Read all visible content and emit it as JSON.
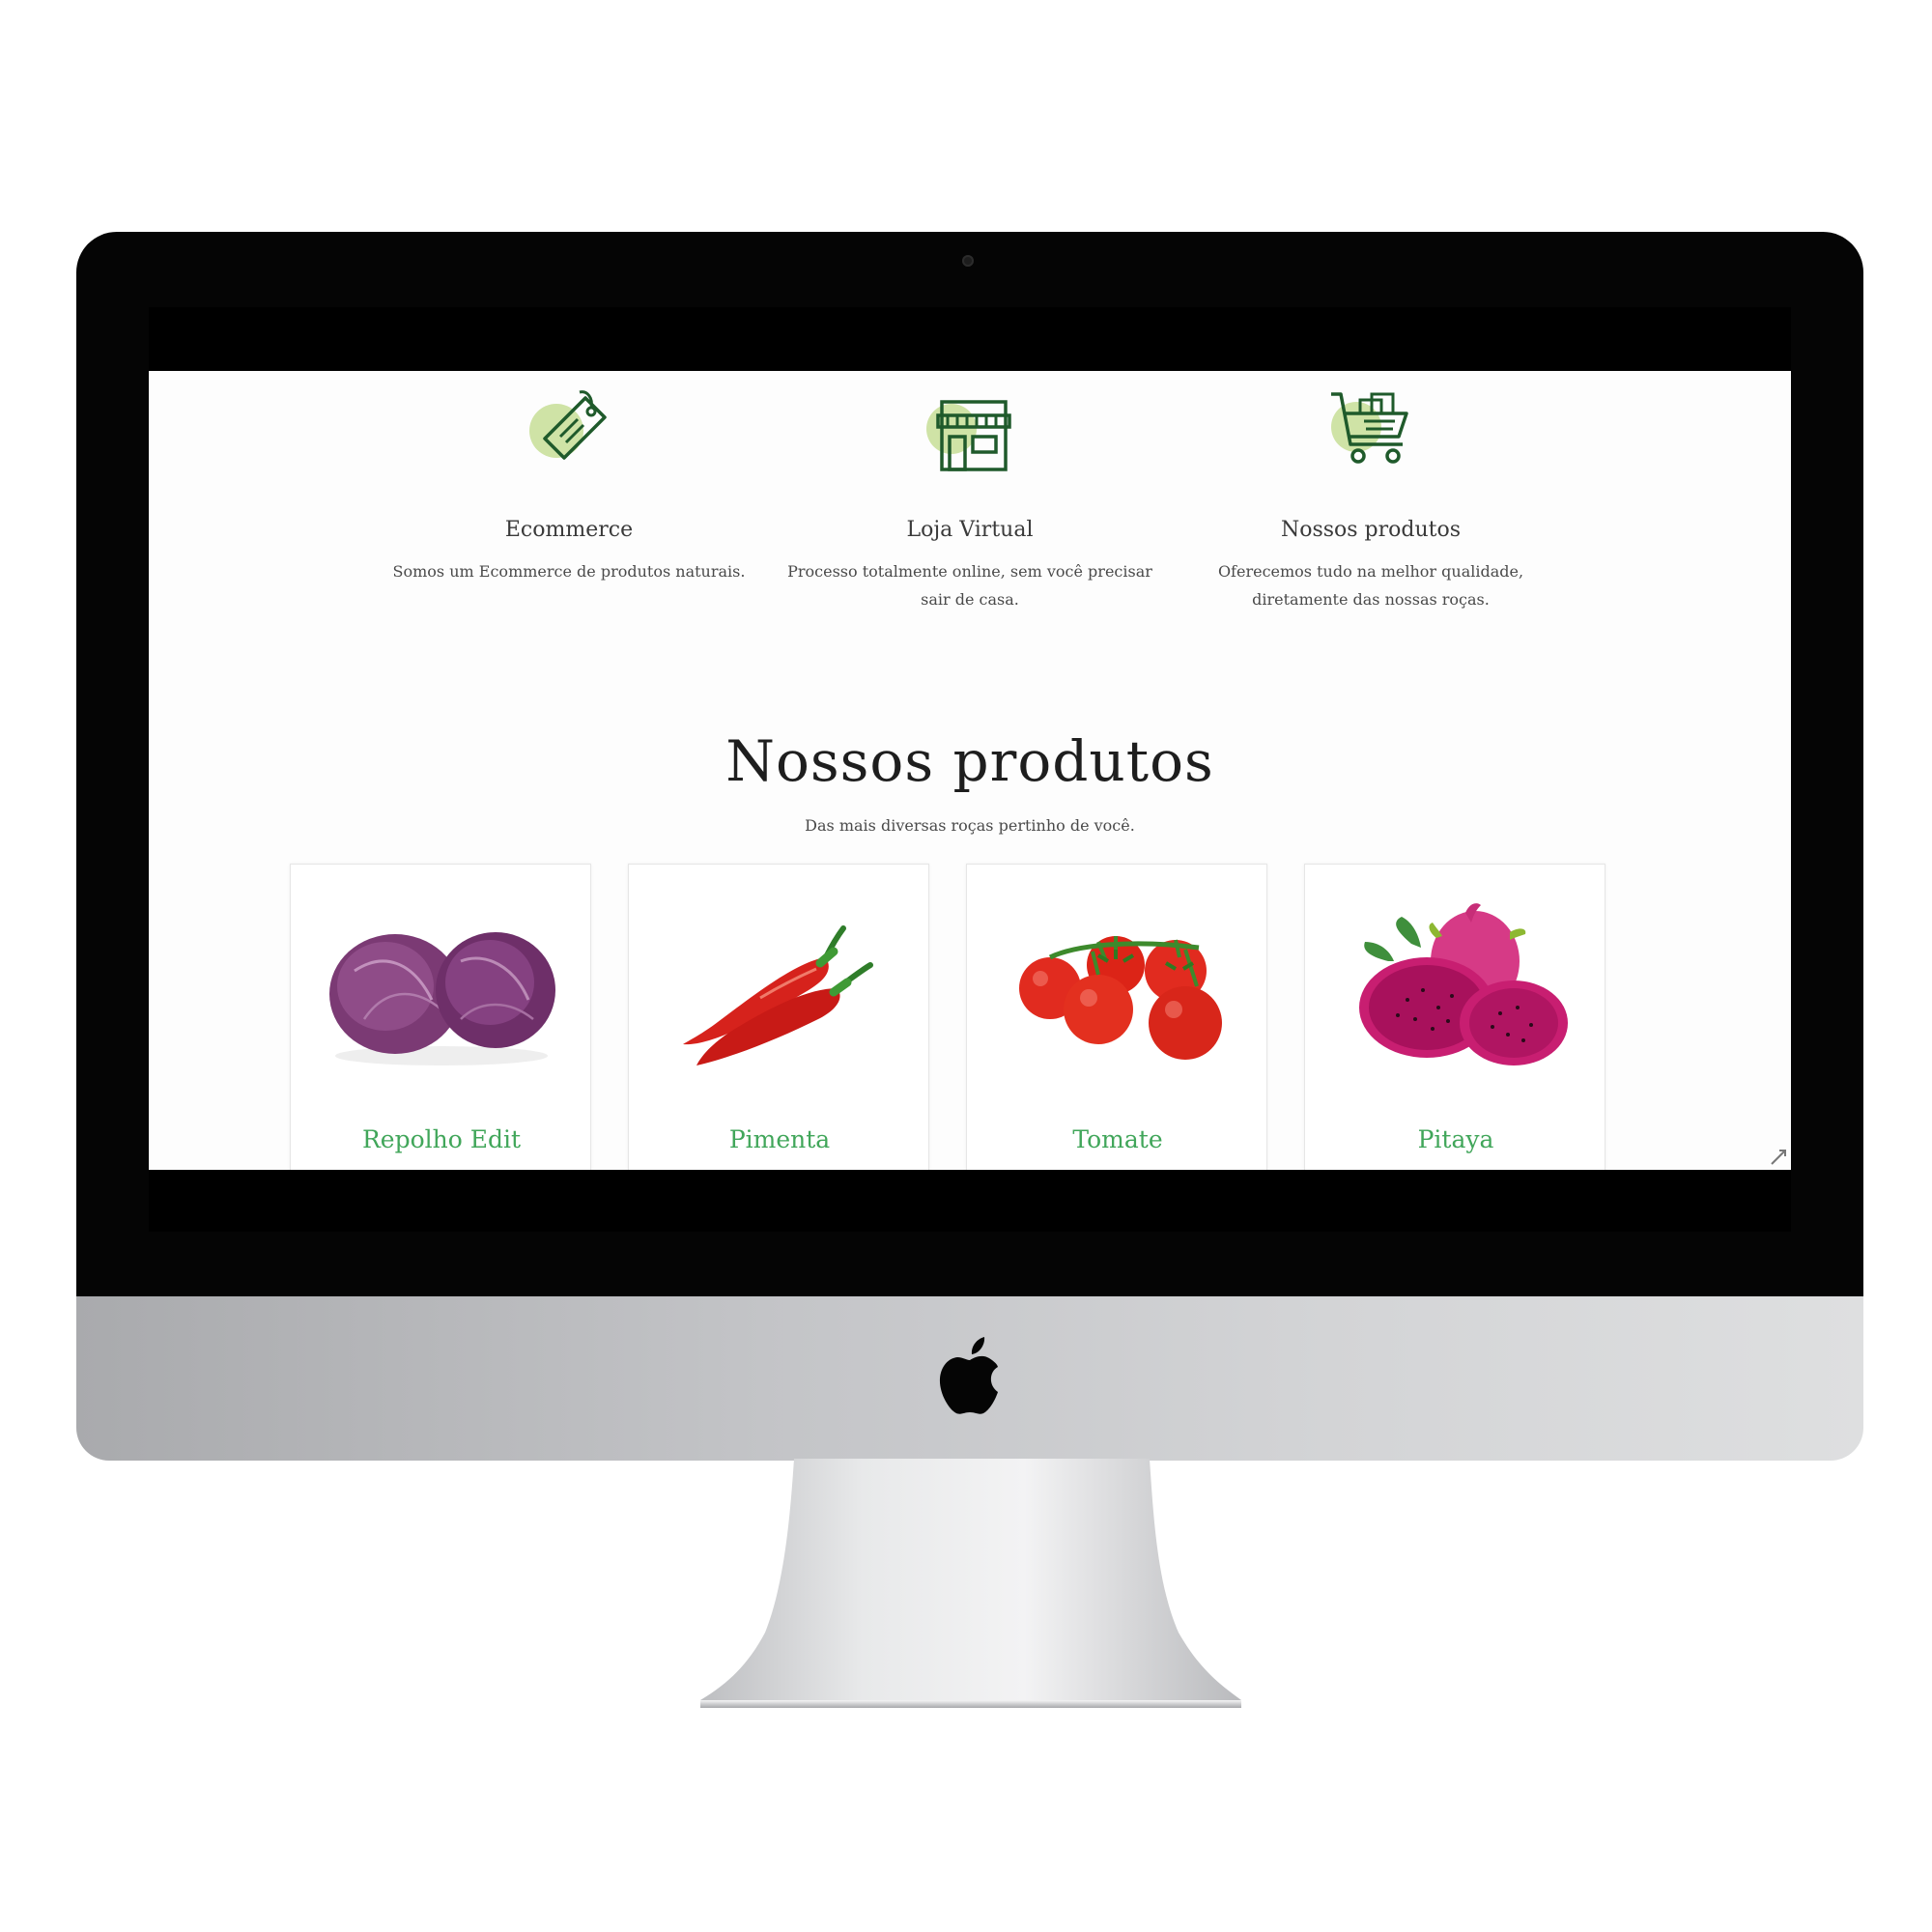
{
  "colors": {
    "accent_green": "#41a65a",
    "icon_green_dark": "#1f5a2b",
    "icon_blob": "#cfe3a6"
  },
  "features": [
    {
      "icon": "price-tag-icon",
      "title": "Ecommerce",
      "description": "Somos um Ecommerce de produtos naturais."
    },
    {
      "icon": "storefront-icon",
      "title": "Loja Virtual",
      "description": "Processo totalmente online, sem você precisar sair de casa."
    },
    {
      "icon": "shopping-cart-icon",
      "title": "Nossos produtos",
      "description": "Oferecemos tudo na melhor qualidade, diretamente das nossas roças."
    }
  ],
  "products_section": {
    "title": "Nossos produtos",
    "subtitle": "Das mais diversas roças pertinho de você."
  },
  "products": [
    {
      "name": "Repolho Edit",
      "image": "red-cabbage-image"
    },
    {
      "name": "Pimenta",
      "image": "chili-pepper-image"
    },
    {
      "name": "Tomate",
      "image": "tomato-image"
    },
    {
      "name": "Pitaya",
      "image": "dragon-fruit-image"
    }
  ]
}
